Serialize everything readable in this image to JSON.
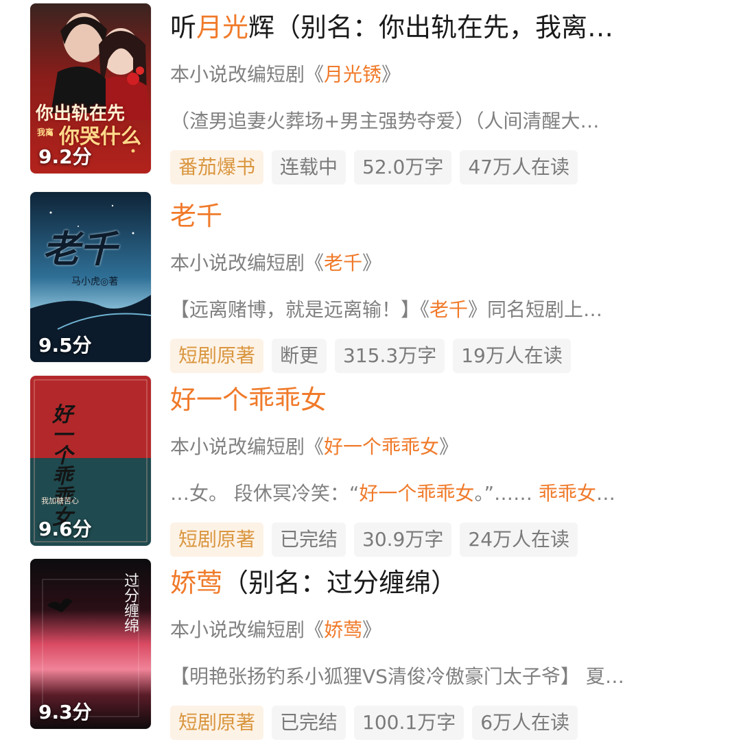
{
  "books": [
    {
      "title_parts": [
        {
          "text": "听",
          "hl": false
        },
        {
          "text": "月光",
          "hl": true
        },
        {
          "text": "辉（别名：你出轨在先，我离…",
          "hl": false
        }
      ],
      "adaptation_prefix": "本小说改编短剧《",
      "adaptation_name": "月光锈",
      "adaptation_suffix": "》",
      "description_parts": [
        {
          "text": "（渣男追妻火葬场+男主强势夺爱）（人间清醒大…",
          "hl": false
        }
      ],
      "score": "9.2分",
      "cover_title": "你出轨在先",
      "cover_subtitle": "你哭什么",
      "cover_small": "我离",
      "tags": {
        "source": "番茄爆书",
        "status": "连载中",
        "words": "52.0万字",
        "readers": "47万人在读"
      }
    },
    {
      "title_parts": [
        {
          "text": "老千",
          "hl": true
        }
      ],
      "adaptation_prefix": "本小说改编短剧《",
      "adaptation_name": "老千",
      "adaptation_suffix": "》",
      "description_parts": [
        {
          "text": "【远离赌博，就是远离输！】《",
          "hl": false
        },
        {
          "text": "老千",
          "hl": true
        },
        {
          "text": "》同名短剧上…",
          "hl": false
        }
      ],
      "score": "9.5分",
      "cover_title": "老千",
      "cover_author": "马小虎◎著",
      "tags": {
        "source": "短剧原著",
        "status": "断更",
        "words": "315.3万字",
        "readers": "19万人在读"
      }
    },
    {
      "title_parts": [
        {
          "text": "好一个乖乖女",
          "hl": true
        }
      ],
      "adaptation_prefix": "本小说改编短剧《",
      "adaptation_name": "好一个乖乖女",
      "adaptation_suffix": "》",
      "description_parts": [
        {
          "text": "…女。 段休冥冷笑：“",
          "hl": false
        },
        {
          "text": "好一个乖乖女",
          "hl": true
        },
        {
          "text": "。”…… ",
          "hl": false
        },
        {
          "text": "乖乖女",
          "hl": true
        },
        {
          "text": "…",
          "hl": false
        }
      ],
      "score": "9.6分",
      "cover_title": "好一个乖乖女",
      "cover_author": "我加糖苦心",
      "tags": {
        "source": "短剧原著",
        "status": "已完结",
        "words": "30.9万字",
        "readers": "24万人在读"
      }
    },
    {
      "title_parts": [
        {
          "text": "娇莺",
          "hl": true
        },
        {
          "text": "（别名：过分缠绵）",
          "hl": false
        }
      ],
      "adaptation_prefix": "本小说改编短剧《",
      "adaptation_name": "娇莺",
      "adaptation_suffix": "》",
      "description_parts": [
        {
          "text": "【明艳张扬钓系小狐狸VS清俊冷傲豪门太子爷】 夏…",
          "hl": false
        }
      ],
      "score": "9.3分",
      "cover_title": "过分缠绵",
      "tags": {
        "source": "短剧原著",
        "status": "已完结",
        "words": "100.1万字",
        "readers": "6万人在读"
      }
    }
  ],
  "colors": {
    "highlight": "#f07a2a",
    "source_tag_bg": "#fdf2e6",
    "source_tag_text": "#d9963f",
    "tag_bg": "#f5f5f5",
    "tag_text": "#7a7a7a",
    "secondary_text": "#808080"
  }
}
